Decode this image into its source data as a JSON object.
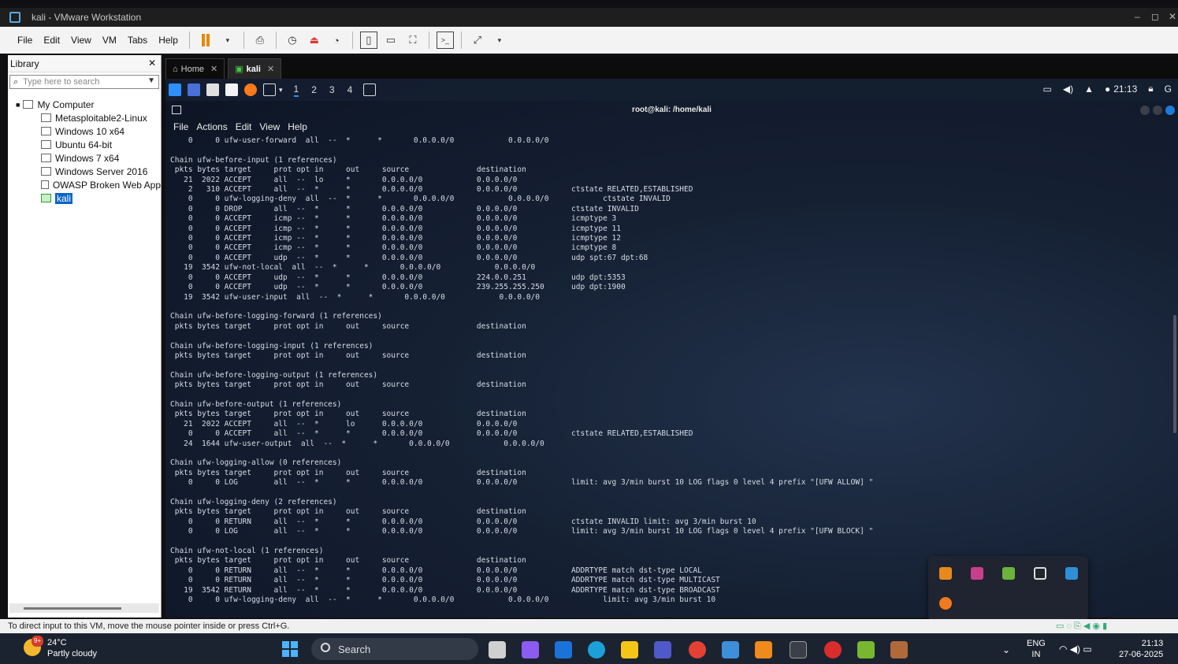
{
  "window": {
    "title": "kali - VMware Workstation",
    "minimize": "–",
    "maximize": "◻",
    "close": "✕"
  },
  "menu": [
    "File",
    "Edit",
    "View",
    "VM",
    "Tabs",
    "Help"
  ],
  "library": {
    "title": "Library",
    "close": "✕",
    "search_placeholder": "Type here to search",
    "root": "My Computer",
    "items": [
      "Metasploitable2-Linux",
      "Windows 10 x64",
      "Ubuntu 64-bit",
      "Windows 7 x64",
      "Windows Server 2016",
      "OWASP Broken Web App",
      "kali"
    ]
  },
  "tabs": [
    {
      "label": "Home",
      "close": "✕"
    },
    {
      "label": "kali",
      "close": "✕"
    }
  ],
  "kali_panel": {
    "workspaces": [
      "1",
      "2",
      "3",
      "4"
    ],
    "clock": "21:13"
  },
  "terminal": {
    "title": "root@kali: /home/kali",
    "menu": [
      "File",
      "Actions",
      "Edit",
      "View",
      "Help"
    ],
    "output": "    0     0 ufw-user-forward  all  --  *      *       0.0.0.0/0            0.0.0.0/0\n\nChain ufw-before-input (1 references)\n pkts bytes target     prot opt in     out     source               destination\n   21  2022 ACCEPT     all  --  lo     *       0.0.0.0/0            0.0.0.0/0\n    2   310 ACCEPT     all  --  *      *       0.0.0.0/0            0.0.0.0/0            ctstate RELATED,ESTABLISHED\n    0     0 ufw-logging-deny  all  --  *      *       0.0.0.0/0            0.0.0.0/0            ctstate INVALID\n    0     0 DROP       all  --  *      *       0.0.0.0/0            0.0.0.0/0            ctstate INVALID\n    0     0 ACCEPT     icmp --  *      *       0.0.0.0/0            0.0.0.0/0            icmptype 3\n    0     0 ACCEPT     icmp --  *      *       0.0.0.0/0            0.0.0.0/0            icmptype 11\n    0     0 ACCEPT     icmp --  *      *       0.0.0.0/0            0.0.0.0/0            icmptype 12\n    0     0 ACCEPT     icmp --  *      *       0.0.0.0/0            0.0.0.0/0            icmptype 8\n    0     0 ACCEPT     udp  --  *      *       0.0.0.0/0            0.0.0.0/0            udp spt:67 dpt:68\n   19  3542 ufw-not-local  all  --  *      *       0.0.0.0/0            0.0.0.0/0\n    0     0 ACCEPT     udp  --  *      *       0.0.0.0/0            224.0.0.251          udp dpt:5353\n    0     0 ACCEPT     udp  --  *      *       0.0.0.0/0            239.255.255.250      udp dpt:1900\n   19  3542 ufw-user-input  all  --  *      *       0.0.0.0/0            0.0.0.0/0\n\nChain ufw-before-logging-forward (1 references)\n pkts bytes target     prot opt in     out     source               destination\n\nChain ufw-before-logging-input (1 references)\n pkts bytes target     prot opt in     out     source               destination\n\nChain ufw-before-logging-output (1 references)\n pkts bytes target     prot opt in     out     source               destination\n\nChain ufw-before-output (1 references)\n pkts bytes target     prot opt in     out     source               destination\n   21  2022 ACCEPT     all  --  *      lo      0.0.0.0/0            0.0.0.0/0\n    0     0 ACCEPT     all  --  *      *       0.0.0.0/0            0.0.0.0/0            ctstate RELATED,ESTABLISHED\n   24  1644 ufw-user-output  all  --  *      *       0.0.0.0/0            0.0.0.0/0\n\nChain ufw-logging-allow (0 references)\n pkts bytes target     prot opt in     out     source               destination\n    0     0 LOG        all  --  *      *       0.0.0.0/0            0.0.0.0/0            limit: avg 3/min burst 10 LOG flags 0 level 4 prefix \"[UFW ALLOW] \"\n\nChain ufw-logging-deny (2 references)\n pkts bytes target     prot opt in     out     source               destination\n    0     0 RETURN     all  --  *      *       0.0.0.0/0            0.0.0.0/0            ctstate INVALID limit: avg 3/min burst 10\n    0     0 LOG        all  --  *      *       0.0.0.0/0            0.0.0.0/0            limit: avg 3/min burst 10 LOG flags 0 level 4 prefix \"[UFW BLOCK] \"\n\nChain ufw-not-local (1 references)\n pkts bytes target     prot opt in     out     source               destination\n    0     0 RETURN     all  --  *      *       0.0.0.0/0            0.0.0.0/0            ADDRTYPE match dst-type LOCAL\n    0     0 RETURN     all  --  *      *       0.0.0.0/0            0.0.0.0/0            ADDRTYPE match dst-type MULTICAST\n   19  3542 RETURN     all  --  *      *       0.0.0.0/0            0.0.0.0/0            ADDRTYPE match dst-type BROADCAST\n    0     0 ufw-logging-deny  all  --  *      *       0.0.0.0/0            0.0.0.0/0            limit: avg 3/min burst 10"
  },
  "status_bar": "To direct input to this VM, move the mouse pointer inside or press Ctrl+G.",
  "taskbar": {
    "weather_temp": "24°C",
    "weather_desc": "Partly cloudy",
    "weather_badge": "9+",
    "search_label": "Search",
    "lang_top": "ENG",
    "lang_bottom": "IN",
    "time": "21:13",
    "date": "27-06-2025"
  },
  "colors": {
    "accent": "#2f8fff",
    "terminal_text": "#d8dde6",
    "taskbar": "#1c2330"
  }
}
